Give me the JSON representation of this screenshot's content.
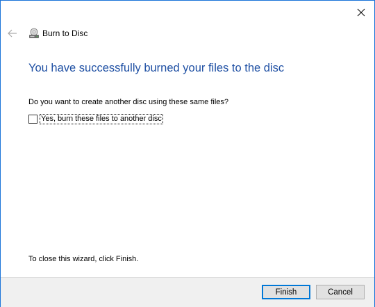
{
  "window": {
    "title": "Burn to Disc"
  },
  "icons": {
    "close": "close-icon",
    "back": "back-arrow-icon",
    "app": "disc-burner-icon"
  },
  "content": {
    "heading": "You have successfully burned your files to the disc",
    "question": "Do you want to create another disc using these same files?",
    "checkbox": {
      "label": "Yes, burn these files to another disc",
      "checked": false
    },
    "footer_text": "To close this wizard, click Finish."
  },
  "buttons": {
    "finish_label": "Finish",
    "cancel_label": "Cancel"
  },
  "colors": {
    "accent": "#0078d7",
    "heading": "#1e4fa3",
    "window_border": "#1a73d9",
    "button_bar": "#f0f0f0"
  }
}
